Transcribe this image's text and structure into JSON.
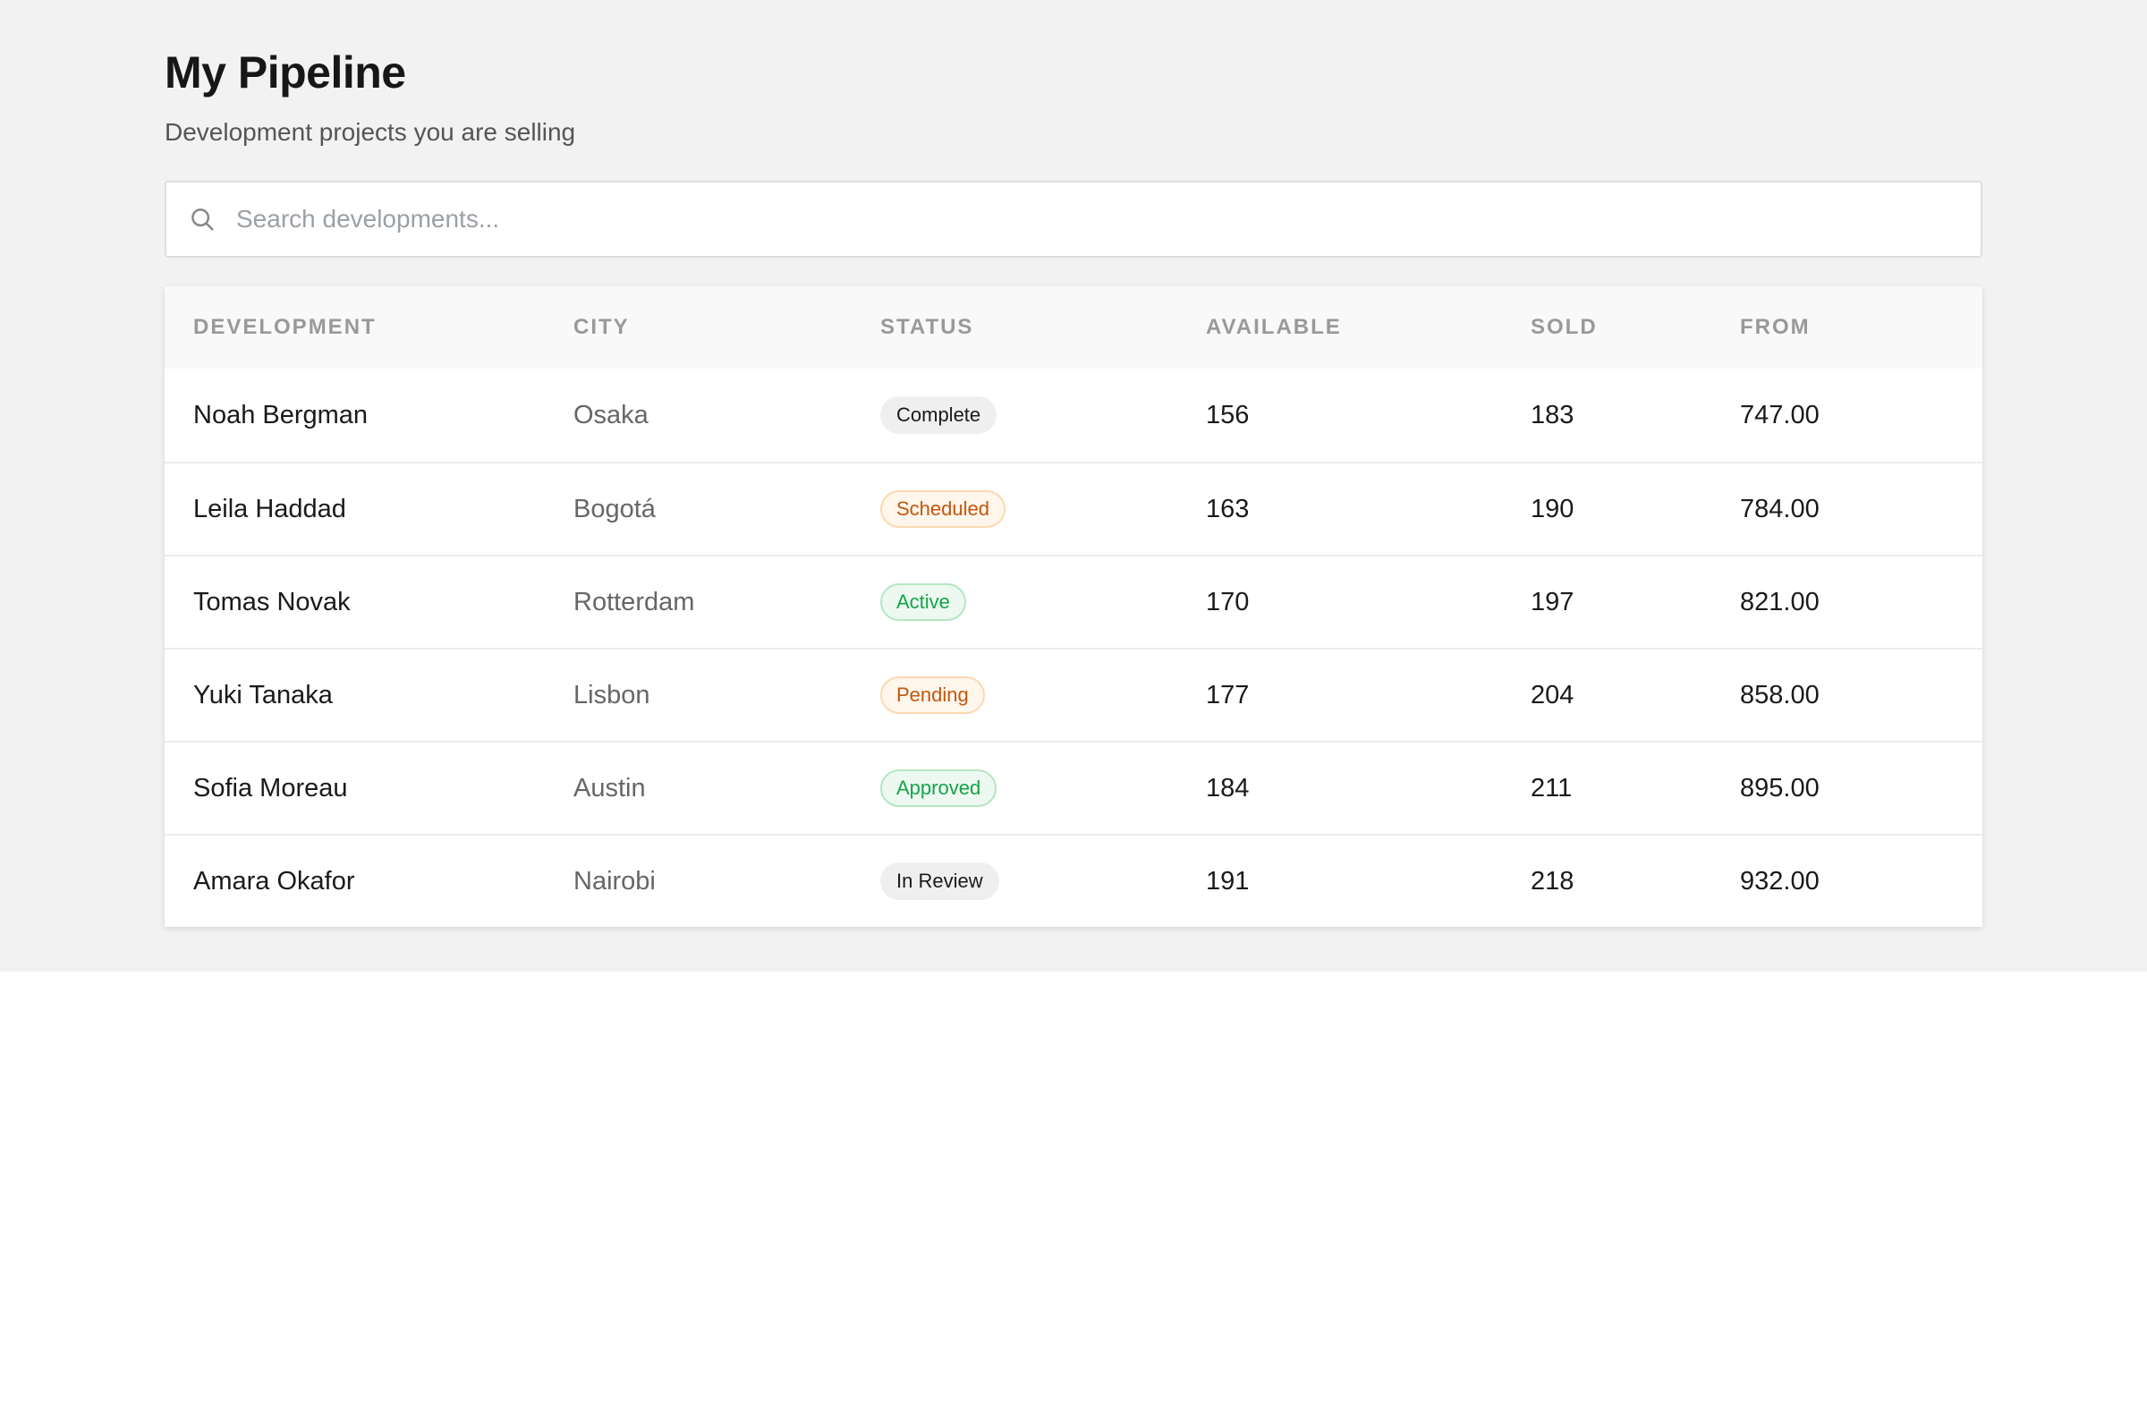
{
  "header": {
    "title": "My Pipeline",
    "subtitle": "Development projects you are selling"
  },
  "search": {
    "placeholder": "Search developments...",
    "value": "",
    "icon": "search-icon"
  },
  "table": {
    "columns": [
      "Development",
      "City",
      "Status",
      "Available",
      "Sold",
      "From"
    ],
    "rows": [
      {
        "development": "Noah Bergman",
        "city": "Osaka",
        "status": "Complete",
        "available": "156",
        "sold": "183",
        "from": "747.00"
      },
      {
        "development": "Leila Haddad",
        "city": "Bogotá",
        "status": "Scheduled",
        "available": "163",
        "sold": "190",
        "from": "784.00"
      },
      {
        "development": "Tomas Novak",
        "city": "Rotterdam",
        "status": "Active",
        "available": "170",
        "sold": "197",
        "from": "821.00"
      },
      {
        "development": "Yuki Tanaka",
        "city": "Lisbon",
        "status": "Pending",
        "available": "177",
        "sold": "204",
        "from": "858.00"
      },
      {
        "development": "Sofia Moreau",
        "city": "Austin",
        "status": "Approved",
        "available": "184",
        "sold": "211",
        "from": "895.00"
      },
      {
        "development": "Amara Okafor",
        "city": "Nairobi",
        "status": "In Review",
        "available": "191",
        "sold": "218",
        "from": "932.00"
      }
    ]
  },
  "status_colors": {
    "Complete": {
      "bg": "#efefef",
      "fg": "#1a1a1a",
      "border": "#efefef"
    },
    "Scheduled": {
      "bg": "#fff6ec",
      "fg": "#c2570c",
      "border": "#fcd9b0"
    },
    "Active": {
      "bg": "#edf9f0",
      "fg": "#16a34a",
      "border": "#b4e6c3"
    },
    "Pending": {
      "bg": "#fff6ec",
      "fg": "#c2570c",
      "border": "#fcd9b0"
    },
    "Approved": {
      "bg": "#edf9f0",
      "fg": "#16a34a",
      "border": "#b4e6c3"
    },
    "In Review": {
      "bg": "#efefef",
      "fg": "#1a1a1a",
      "border": "#efefef"
    }
  }
}
